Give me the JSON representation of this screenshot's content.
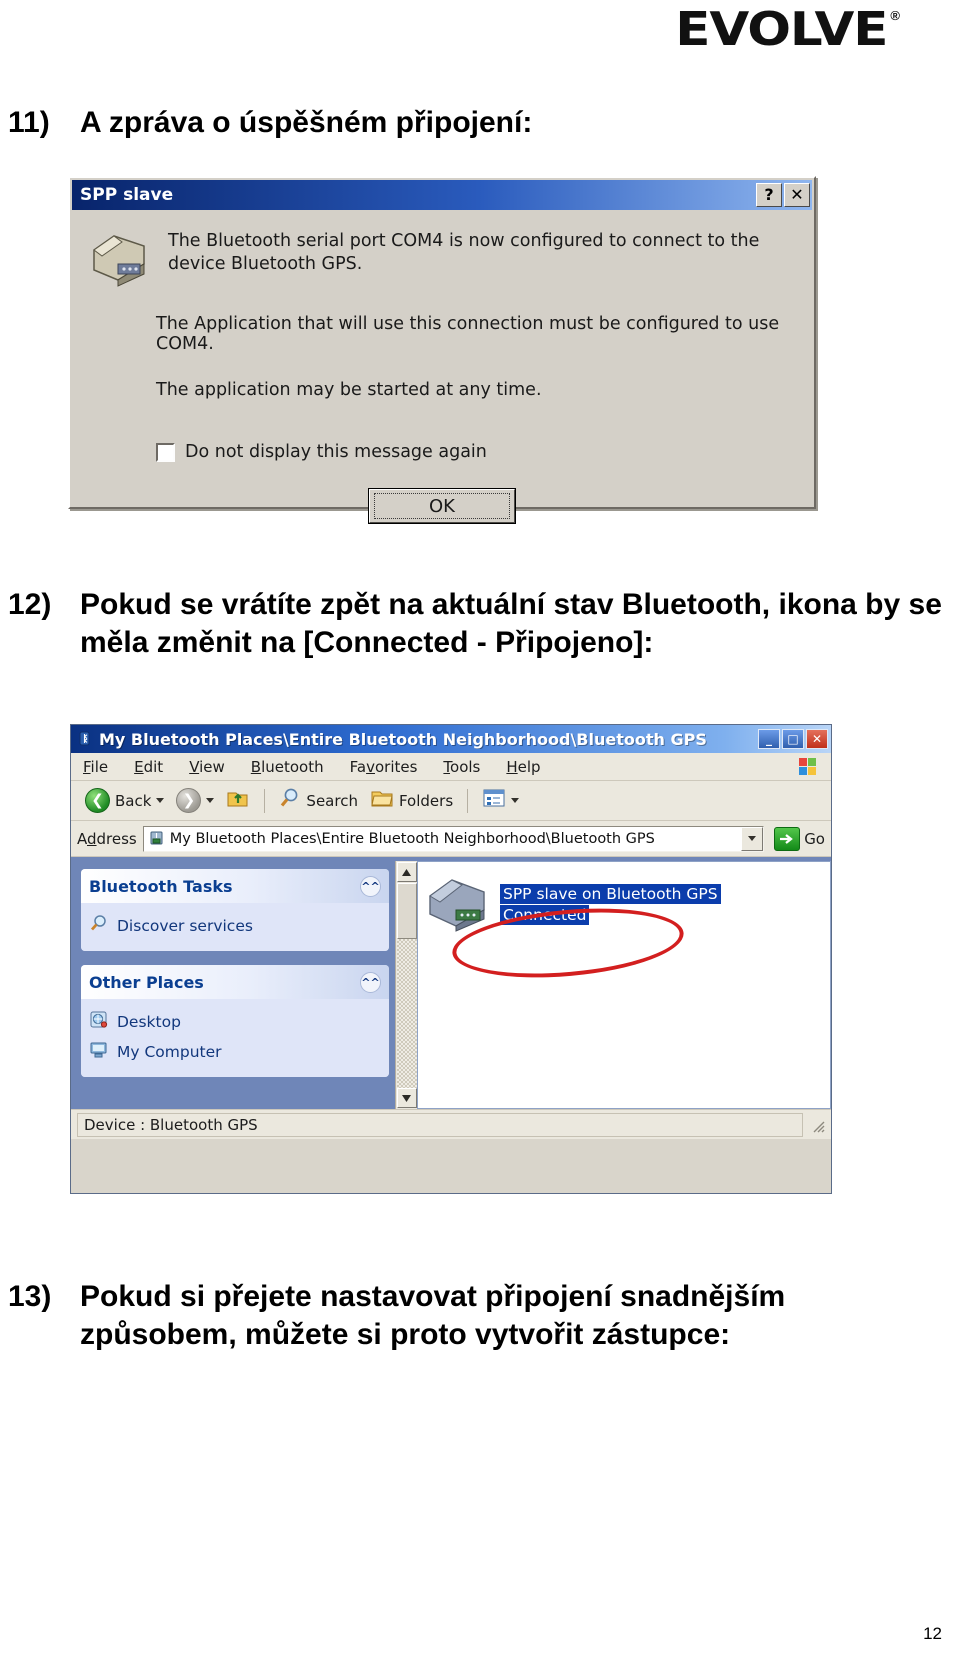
{
  "brand": {
    "name": "EVOLVE",
    "reg": "®"
  },
  "steps": {
    "s11": {
      "num": "11)",
      "text": "A zpráva o úspěšném připojení:"
    },
    "s12": {
      "num": "12)",
      "text": "Pokud se vrátíte zpět na aktuální stav Bluetooth, ikona by se měla změnit na [Connected - Připojeno]:"
    },
    "s13": {
      "num": "13)",
      "text": "Pokud si přejete nastavovat připojení snadnějším způsobem, můžete si proto vytvořit zástupce:"
    }
  },
  "page_number": "12",
  "dialog": {
    "title": "SPP slave",
    "help_button": "?",
    "close_button": "✕",
    "icon": "serial-port-plug-icon",
    "message_1": "The Bluetooth serial port COM4 is now configured to connect to the device Bluetooth GPS.",
    "message_2": "The Application that will use this connection must be configured to use COM4.",
    "message_3": "The application may be started at any time.",
    "checkbox_label": "Do not display this message again",
    "checkbox_checked": false,
    "ok_label": "OK"
  },
  "explorer": {
    "title": "My Bluetooth Places\\Entire Bluetooth Neighborhood\\Bluetooth GPS",
    "title_icon": "bluetooth-places-icon",
    "window_buttons": {
      "minimize": "_",
      "maximize": "□",
      "close": "✕"
    },
    "menus": [
      {
        "pre": "",
        "accel": "F",
        "post": "ile"
      },
      {
        "pre": "",
        "accel": "E",
        "post": "dit"
      },
      {
        "pre": "",
        "accel": "V",
        "post": "iew"
      },
      {
        "pre": "",
        "accel": "B",
        "post": "luetooth"
      },
      {
        "pre": "Fa",
        "accel": "v",
        "post": "orites"
      },
      {
        "pre": "",
        "accel": "T",
        "post": "ools"
      },
      {
        "pre": "",
        "accel": "H",
        "post": "elp"
      }
    ],
    "toolbar": {
      "back_label": "Back",
      "back_icon": "back-arrow-icon",
      "forward_icon": "forward-arrow-icon",
      "up_icon": "up-folder-icon",
      "search_label": "Search",
      "search_icon": "search-icon",
      "folders_label": "Folders",
      "folders_icon": "folder-icon",
      "views_icon": "views-icon"
    },
    "address": {
      "label_pre": "A",
      "label_accel": "d",
      "label_post": "dress",
      "icon": "bluetooth-places-icon",
      "value": "My Bluetooth Places\\Entire Bluetooth Neighborhood\\Bluetooth GPS",
      "dropdown_icon": "chevron-down-icon",
      "go_label": "Go",
      "go_icon": "go-arrow-icon"
    },
    "task_panes": [
      {
        "title": "Bluetooth Tasks",
        "collapse_icon": "chevron-up-icon",
        "items": [
          {
            "label": "Discover services",
            "icon": "search-icon"
          }
        ]
      },
      {
        "title": "Other Places",
        "collapse_icon": "chevron-up-icon",
        "items": [
          {
            "label": "Desktop",
            "icon": "desktop-icon"
          },
          {
            "label": "My Computer",
            "icon": "my-computer-icon"
          }
        ]
      }
    ],
    "files": [
      {
        "icon": "serial-port-plug-icon",
        "name": "SPP slave on Bluetooth GPS",
        "status": "Connected",
        "selected": true
      }
    ],
    "scrollbar": {
      "up_icon": "chevron-up-icon",
      "down_icon": "chevron-down-icon"
    },
    "statusbar": {
      "text": "Device : Bluetooth GPS",
      "grip": "resize-grip-icon"
    },
    "annotation": {
      "shape": "red-ellipse-highlight",
      "color": "#d31f1f"
    }
  }
}
